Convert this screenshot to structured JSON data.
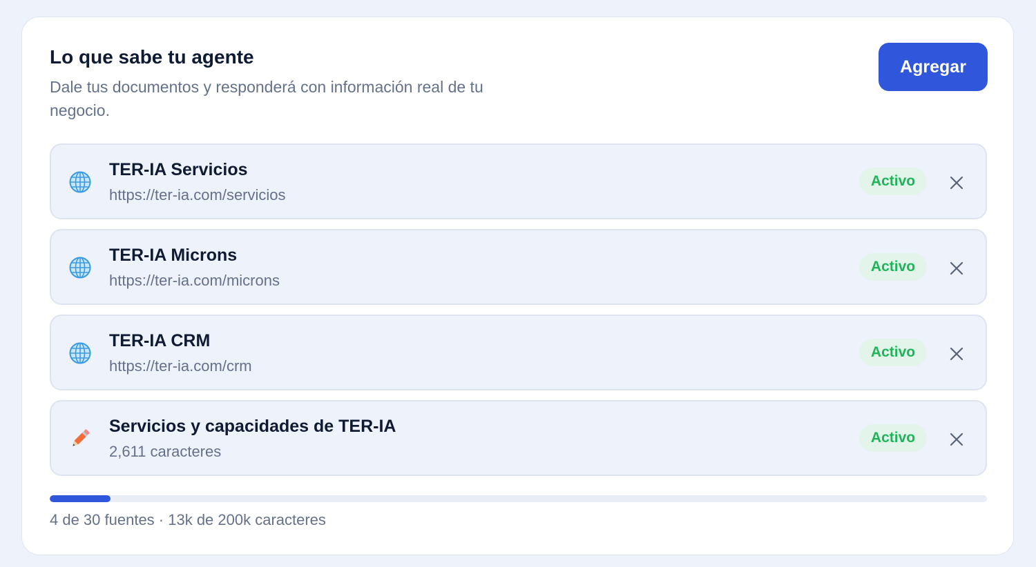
{
  "header": {
    "title": "Lo que sabe tu agente",
    "subtitle": "Dale tus documentos y responderá con información real de tu negocio.",
    "add_button_label": "Agregar"
  },
  "sources": [
    {
      "icon": "globe-icon",
      "title": "TER-IA Servicios",
      "subtitle": "https://ter-ia.com/servicios",
      "status": "Activo"
    },
    {
      "icon": "globe-icon",
      "title": "TER-IA Microns",
      "subtitle": "https://ter-ia.com/microns",
      "status": "Activo"
    },
    {
      "icon": "globe-icon",
      "title": "TER-IA CRM",
      "subtitle": "https://ter-ia.com/crm",
      "status": "Activo"
    },
    {
      "icon": "pencil-icon",
      "title": "Servicios y capacidades de TER-IA",
      "subtitle": "2,611 caracteres",
      "status": "Activo"
    }
  ],
  "usage": {
    "text": "4 de 30 fuentes · 13k de 200k caracteres",
    "progress_fraction": 0.065
  },
  "colors": {
    "accent": "#2f56db",
    "status_active_text": "#1fb45a",
    "status_active_bg": "#e3f4ea",
    "page_background": "#edf2fb"
  }
}
